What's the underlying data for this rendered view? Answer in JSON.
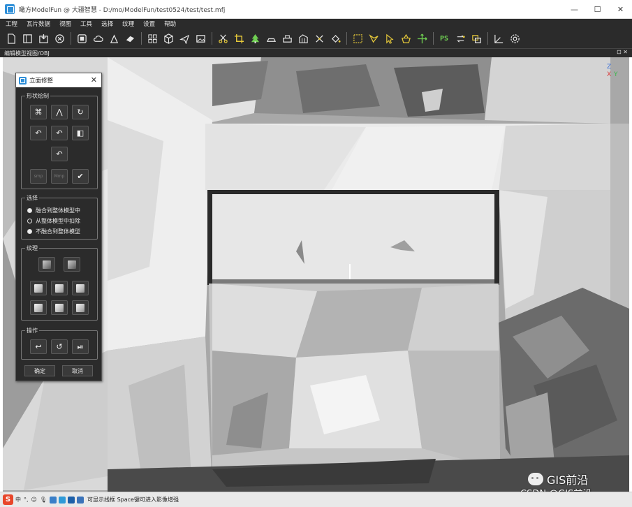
{
  "window": {
    "title": "瞰方ModelFun @ 大疆智慧 - D:/mo/ModelFun/test0524/test/test.mfj",
    "minimize_glyph": "—",
    "maximize_glyph": "☐",
    "close_glyph": "✕"
  },
  "menu": [
    "工程",
    "瓦片数据",
    "视图",
    "工具",
    "选择",
    "纹理",
    "设置",
    "帮助"
  ],
  "toolbar": {
    "groups": [
      [
        "new-file-icon",
        "open-file-icon",
        "save-file-icon",
        "close-file-icon"
      ],
      [
        "stop-icon",
        "cloud-icon",
        "import-icon",
        "export-icon"
      ],
      [
        "grid-icon",
        "cube-icon",
        "plane-icon",
        "image-icon"
      ],
      [
        "scissors-icon",
        "crop-icon",
        "tree-icon",
        "flatten-icon",
        "print-icon",
        "building-icon",
        "edit-off-icon",
        "paint-bucket-icon"
      ],
      [
        "select-rect-icon",
        "select-poly-icon",
        "pointer-icon",
        "basket-icon",
        "move-icon"
      ],
      [
        "photoshop-icon",
        "sync-icon",
        "link-icon"
      ],
      [
        "angle-icon",
        "settings-icon"
      ]
    ],
    "ps_label": "PS"
  },
  "view": {
    "title": "编辑模型视图/OBJ",
    "controls": "⊡ ✕",
    "axes": {
      "z": "Z",
      "x": "X",
      "y": "Y"
    }
  },
  "panel": {
    "title": "立面修整",
    "close": "✕",
    "shape_group": {
      "label": "形状绘制",
      "buttons": [
        "⌘",
        "⋀",
        "↻",
        "↶",
        "↶",
        "◧",
        "↶"
      ],
      "dim_buttons": [
        "smp",
        "Mmp"
      ],
      "confirm": "✔"
    },
    "select_group": {
      "label": "选择",
      "options": [
        {
          "label": "融合到整体模型中",
          "checked": true
        },
        {
          "label": "从整体模型中扣除",
          "checked": false
        },
        {
          "label": "不融合到整体模型",
          "checked": true
        }
      ]
    },
    "texture_group": {
      "label": "纹理"
    },
    "ops_group": {
      "label": "操作",
      "buttons": [
        "↩",
        "↺",
        "⏯"
      ]
    },
    "ok": "确定",
    "cancel": "取消"
  },
  "statusbar": {
    "ime_logo": "S",
    "ime_mode": "中",
    "ime_punct": "°,",
    "ime_emoji": "☺",
    "ime_voice": "🎙",
    "message": "可显示线框 Space键可进入影像增强"
  },
  "watermark": {
    "wechat": "GIS前沿",
    "csdn": "CSDN @GIS前沿"
  }
}
